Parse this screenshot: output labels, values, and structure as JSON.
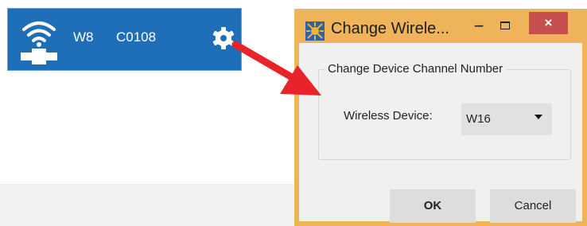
{
  "device_tile": {
    "name": "W8",
    "code": "C0108",
    "icons": {
      "wireless": "wireless-device-icon",
      "settings": "gear-icon"
    },
    "background_color": "#1f6fb8"
  },
  "arrow": {
    "icon": "red-arrow-pointer",
    "color": "#e8232a"
  },
  "dialog": {
    "title": "Change Wirele...",
    "controls": {
      "minimize": "−",
      "close": "×"
    },
    "accent_color": "#efb35a",
    "group_title": "Change Device Channel Number",
    "wireless_device_label": "Wireless Device:",
    "wireless_device_value": "W16",
    "ok_label": "OK",
    "cancel_label": "Cancel"
  }
}
